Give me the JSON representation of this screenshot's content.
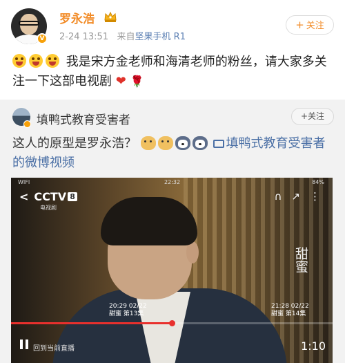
{
  "post": {
    "username": "罗永浩",
    "timestamp": "2-24 13:51",
    "source_prefix": "来自",
    "source": "坚果手机 R1",
    "follow_label": "关注",
    "text": "我是宋方金老师和海清老师的粉丝，请大家多关注一下这部电视剧",
    "emoji_icon": "laughing-emoji-icon",
    "heart_icon": "❤",
    "rose_icon": "🌹"
  },
  "repost": {
    "username": "填鸭式教育受害者",
    "follow_label": "关注",
    "text": "这人的原型是罗永浩？",
    "video_link": "填鸭式教育受害者的微博视频"
  },
  "video": {
    "status_wifi": "WIFI",
    "status_clock": "22:32",
    "status_battery": "84%",
    "channel_logo": "CCTV",
    "channel_number": "8",
    "channel_sub": "电视剧",
    "watermark": "甜蜜",
    "episode1_time": "20:29 02/22",
    "episode1_title": "甜蜜 第13集",
    "episode2_time": "21:28 02/22",
    "episode2_title": "甜蜜 第14集",
    "live_label": "回到当前直播",
    "duration": "1:10",
    "progress": 0.5,
    "accent_color": "#e8302d"
  },
  "colors": {
    "username": "#f28c28",
    "link": "#4a6fa5",
    "repost_bg": "#f2f2f2"
  }
}
